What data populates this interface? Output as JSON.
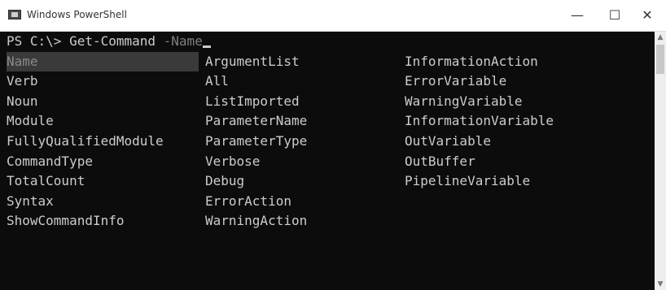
{
  "window": {
    "title": "Windows PowerShell",
    "icon": "powershell-icon",
    "controls": {
      "minimize": "—",
      "maximize": "☐",
      "close": "✕"
    }
  },
  "terminal": {
    "prompt": "PS C:\\> Get-Command ",
    "typed_param": "-Name",
    "columns": [
      [
        "Name",
        "Verb",
        "Noun",
        "Module",
        "FullyQualifiedModule",
        "CommandType",
        "TotalCount",
        "Syntax",
        "ShowCommandInfo"
      ],
      [
        "ArgumentList",
        "All",
        "ListImported",
        "ParameterName",
        "ParameterType",
        "Verbose",
        "Debug",
        "ErrorAction",
        "WarningAction"
      ],
      [
        "InformationAction",
        "ErrorVariable",
        "WarningVariable",
        "InformationVariable",
        "OutVariable",
        "OutBuffer",
        "PipelineVariable"
      ]
    ],
    "selected_item": "Name",
    "colors": {
      "background": "#0c0c0c",
      "foreground": "#cccccc",
      "selection": "#3a3a3a"
    }
  },
  "scrollbar": {
    "up_arrow": "▲",
    "down_arrow": "▼"
  }
}
